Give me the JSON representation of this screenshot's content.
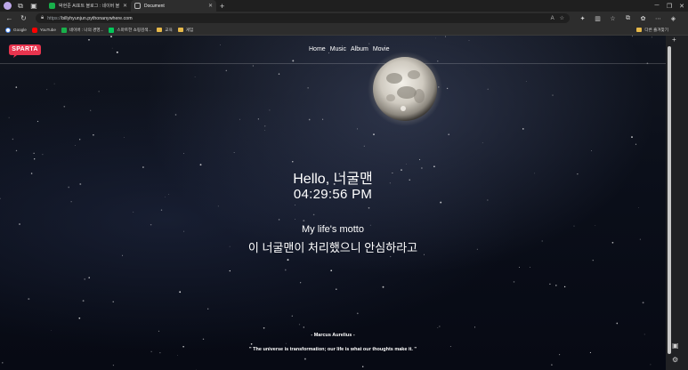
{
  "browser": {
    "tabs": [
      {
        "title": "박현준 AI포트 블로그 : 네이버 블",
        "favicon": "naver",
        "active": false
      },
      {
        "title": "Document",
        "favicon": "document",
        "active": true
      }
    ],
    "new_tab": "+",
    "address": {
      "protocol": "https://",
      "domain": "billyhyunjun.pythonanywhere.com"
    },
    "bookmarks": [
      {
        "label": "Google",
        "icon": "google-icon"
      },
      {
        "label": "YouTube",
        "icon": "youtube-icon"
      },
      {
        "label": "네이버 : 나의 경영...",
        "icon": "naver-icon"
      },
      {
        "label": "스마트한 쇼핑검색...",
        "icon": "smartstore-icon"
      },
      {
        "label": "교육",
        "icon": "folder-icon"
      },
      {
        "label": "게임",
        "icon": "folder-icon"
      }
    ],
    "other_bookmarks": "다른 즐겨찾기",
    "colors": {
      "chrome": "#2d2d2d",
      "tabbar": "#1f1f1f"
    }
  },
  "page": {
    "logo": "SPARTA",
    "nav": [
      "Home",
      "Music",
      "Album",
      "Movie"
    ],
    "greeting": "Hello, 너굴맨",
    "clock": "04:29:56 PM",
    "motto_label": "My life's motto",
    "motto": "이 너굴맨이 처리했으니 안심하라고",
    "quote_author": "- Marcus Aurelius -",
    "quote_text": "\" The universe is transformation; our life is what our thoughts make it. \"",
    "colors": {
      "logo": "#e8344e",
      "text": "#ffffff",
      "sky": "#0b0f1a"
    }
  }
}
